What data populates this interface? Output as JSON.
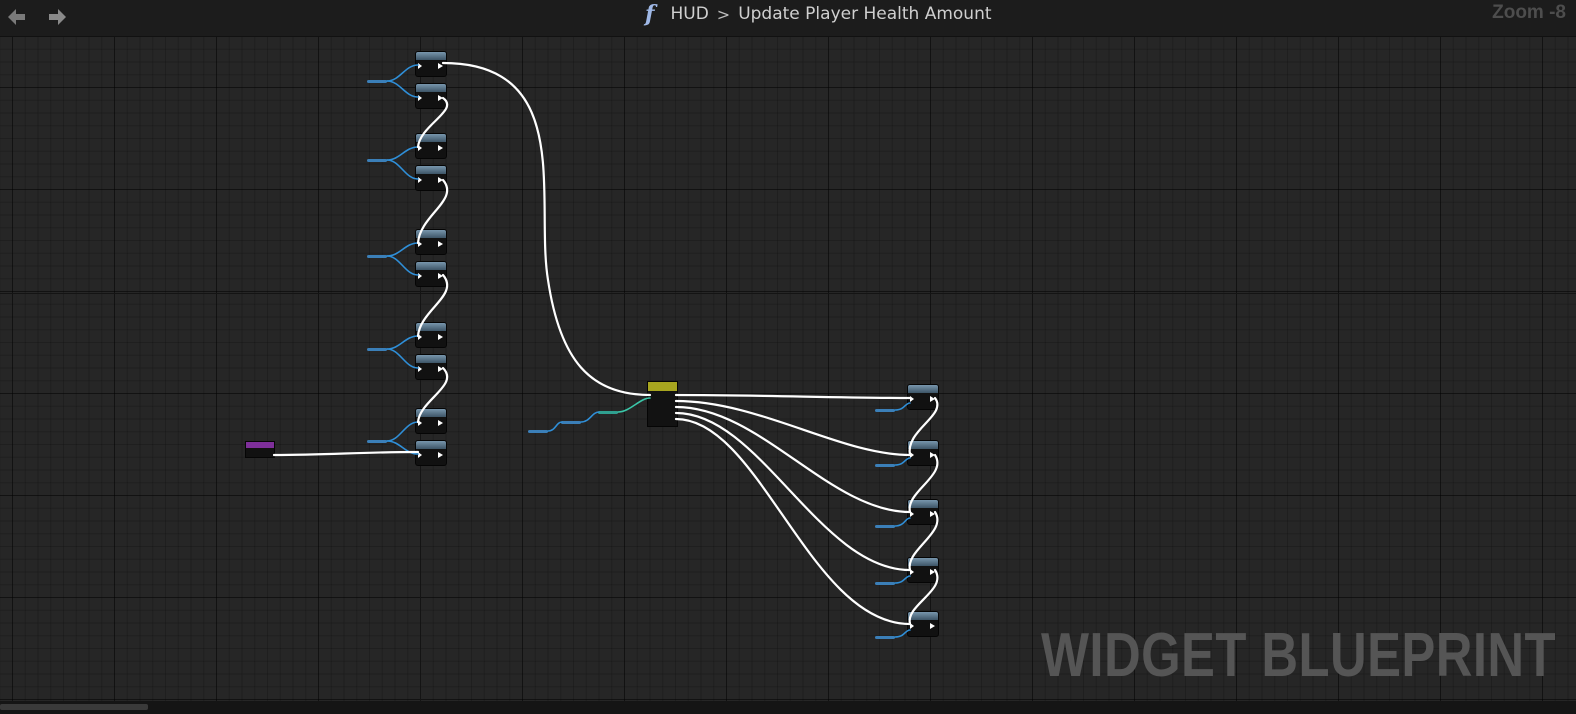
{
  "toolbar": {
    "back_icon": "arrow-left-icon",
    "forward_icon": "arrow-right-icon"
  },
  "breadcrumb": {
    "function_icon": "function-icon",
    "function_glyph": "f",
    "parent": "HUD",
    "separator": ">",
    "current": "Update Player Health Amount"
  },
  "zoom_label": "Zoom -8",
  "watermark": "WIDGET BLUEPRINT",
  "colors": {
    "background": "#262626",
    "exec_wire": "#ffffff",
    "object_wire": "#2f8fd8",
    "struct_wire": "#3ac6a8",
    "event_header": "#7e2f9a",
    "sequence_header": "#a7a51f",
    "function_header": "#5f7b91"
  }
}
